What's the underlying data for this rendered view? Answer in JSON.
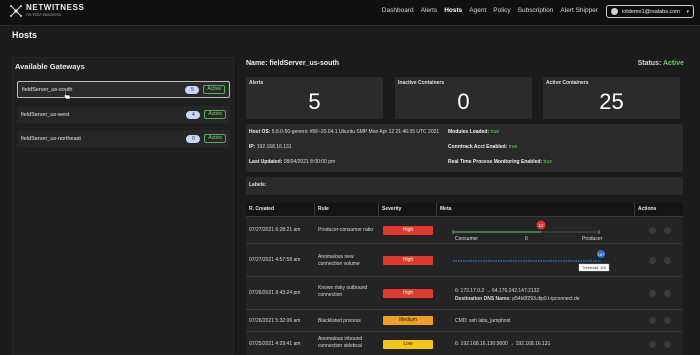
{
  "app": {
    "logo_main": "NETWITNESS",
    "logo_sub": "An RSA Business"
  },
  "nav": [
    "Dashboard",
    "Alerts",
    "Hosts",
    "Agent",
    "Policy",
    "Subscription",
    "Alert Shipper"
  ],
  "nav_active": "Hosts",
  "user": {
    "name": "iotdemo1@rsalabs.com"
  },
  "page_title": "Hosts",
  "gateways": {
    "title": "Available Gateways",
    "items": [
      {
        "name": "fieldServer_us-south",
        "count": "5",
        "status": "Active"
      },
      {
        "name": "fieldServer_us-west",
        "count": "4",
        "status": "Active"
      },
      {
        "name": "fieldServer_us-northeast",
        "count": "0",
        "status": "Active"
      }
    ]
  },
  "detail": {
    "name_label": "Name:",
    "name": "fieldServer_us-south",
    "status_label": "Status:",
    "status": "Active",
    "stats": [
      {
        "label": "Alerts",
        "value": "5"
      },
      {
        "label": "Inactive Containers",
        "value": "0"
      },
      {
        "label": "Active Containers",
        "value": "25"
      }
    ],
    "info": {
      "host_os_label": "Host OS:",
      "host_os": "5.8.0-50-generic #56~20.04.1 Ubuntu SMP Mon Apr 12 21:46:35 UTC 2021",
      "ip_label": "IP:",
      "ip": "192.168.16.131",
      "last_updated_label": "Last Updated:",
      "last_updated": "08/04/2021 8:00:00 pm",
      "modules_label": "Modules Loaded:",
      "modules": "true",
      "conntrack_label": "Conntrack Acct Enabled:",
      "conntrack": "true",
      "rtpm_label": "Real Time Process Monitoring Enabled:",
      "rtpm": "true"
    },
    "labels_title": "Labels:"
  },
  "table": {
    "headers": [
      "R. Created",
      "Rule",
      "Severity",
      "Meta",
      "Actions"
    ],
    "rows": [
      {
        "created": "07/27/2021 6:28:21 am",
        "rule": "Producer-consumer ratio",
        "severity": "High",
        "sev_class": "high",
        "meta_type": "ratio",
        "meta_left": "Consumer",
        "meta_mid": "0",
        "meta_right": "Producer",
        "meta_badge": "12"
      },
      {
        "created": "07/27/2021 4:57:58 am",
        "rule": "Anomalous new connection volume",
        "severity": "High",
        "sev_class": "high",
        "meta_type": "threshold",
        "meta_badge": "167",
        "meta_threshold": "Threshold: 119"
      },
      {
        "created": "07/26/2021 8:43:24 pm",
        "rule": "Known risky outbound connection",
        "severity": "High",
        "sev_class": "high",
        "meta_type": "text",
        "meta_line1": "6:  172.17.0.2  →  64.176.242.147:2132",
        "meta_line2_label": "Destination DNS Name:",
        "meta_line2": "p54b0f293.dip0.t-ipconnect.de"
      },
      {
        "created": "07/26/2021 5:32:06 am",
        "rule": "Blacklisted process",
        "severity": "Medium",
        "sev_class": "medium",
        "meta_type": "text",
        "meta_line1": "CMD:  ssh labs_jumphost",
        "meta_line2_label": "",
        "meta_line2": ""
      },
      {
        "created": "07/25/2021 4:29:41 am",
        "rule": "Anomalous inbound connection sidebcal",
        "severity": "Low",
        "sev_class": "low",
        "meta_type": "text",
        "meta_line1": "6:  192.168.16.130:9000  →  192.168.16.131",
        "meta_line2_label": "",
        "meta_line2": ""
      }
    ]
  },
  "colors": {
    "accent_green": "#5fd35f",
    "high": "#e0392b",
    "medium": "#f0a020",
    "low": "#f5c518"
  }
}
